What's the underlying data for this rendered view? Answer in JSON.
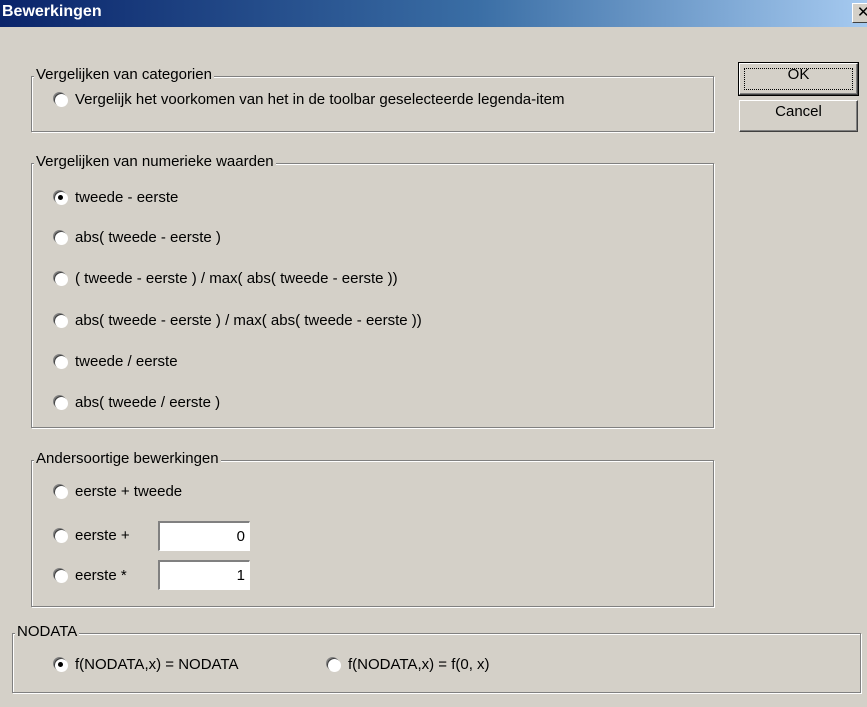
{
  "window": {
    "title": "Bewerkingen",
    "close_glyph": "✕"
  },
  "buttons": {
    "ok_label": "OK",
    "cancel_label": "Cancel"
  },
  "groups": {
    "categories": {
      "title": "Vergelijken van categorien",
      "options": [
        {
          "label": "Vergelijk het voorkomen van het in de toolbar geselecteerde legenda-item",
          "checked": false
        }
      ]
    },
    "numeric": {
      "title": "Vergelijken van numerieke waarden",
      "options": [
        {
          "label": "tweede - eerste",
          "checked": true
        },
        {
          "label": "abs( tweede - eerste )",
          "checked": false
        },
        {
          "label": "( tweede - eerste ) / max( abs( tweede - eerste ))",
          "checked": false
        },
        {
          "label": "abs( tweede - eerste ) / max( abs( tweede - eerste ))",
          "checked": false
        },
        {
          "label": "tweede / eerste",
          "checked": false
        },
        {
          "label": "abs( tweede / eerste )",
          "checked": false
        }
      ]
    },
    "other": {
      "title": "Andersoortige bewerkingen",
      "options": [
        {
          "label": "eerste + tweede",
          "checked": false
        },
        {
          "label": "eerste +",
          "checked": false,
          "value": "0"
        },
        {
          "label": "eerste *",
          "checked": false,
          "value": "1"
        }
      ]
    },
    "nodata": {
      "title": "NODATA",
      "options": [
        {
          "label": "f(NODATA,x) = NODATA",
          "checked": true
        },
        {
          "label": "f(NODATA,x) = f(0, x)",
          "checked": false
        }
      ]
    }
  }
}
